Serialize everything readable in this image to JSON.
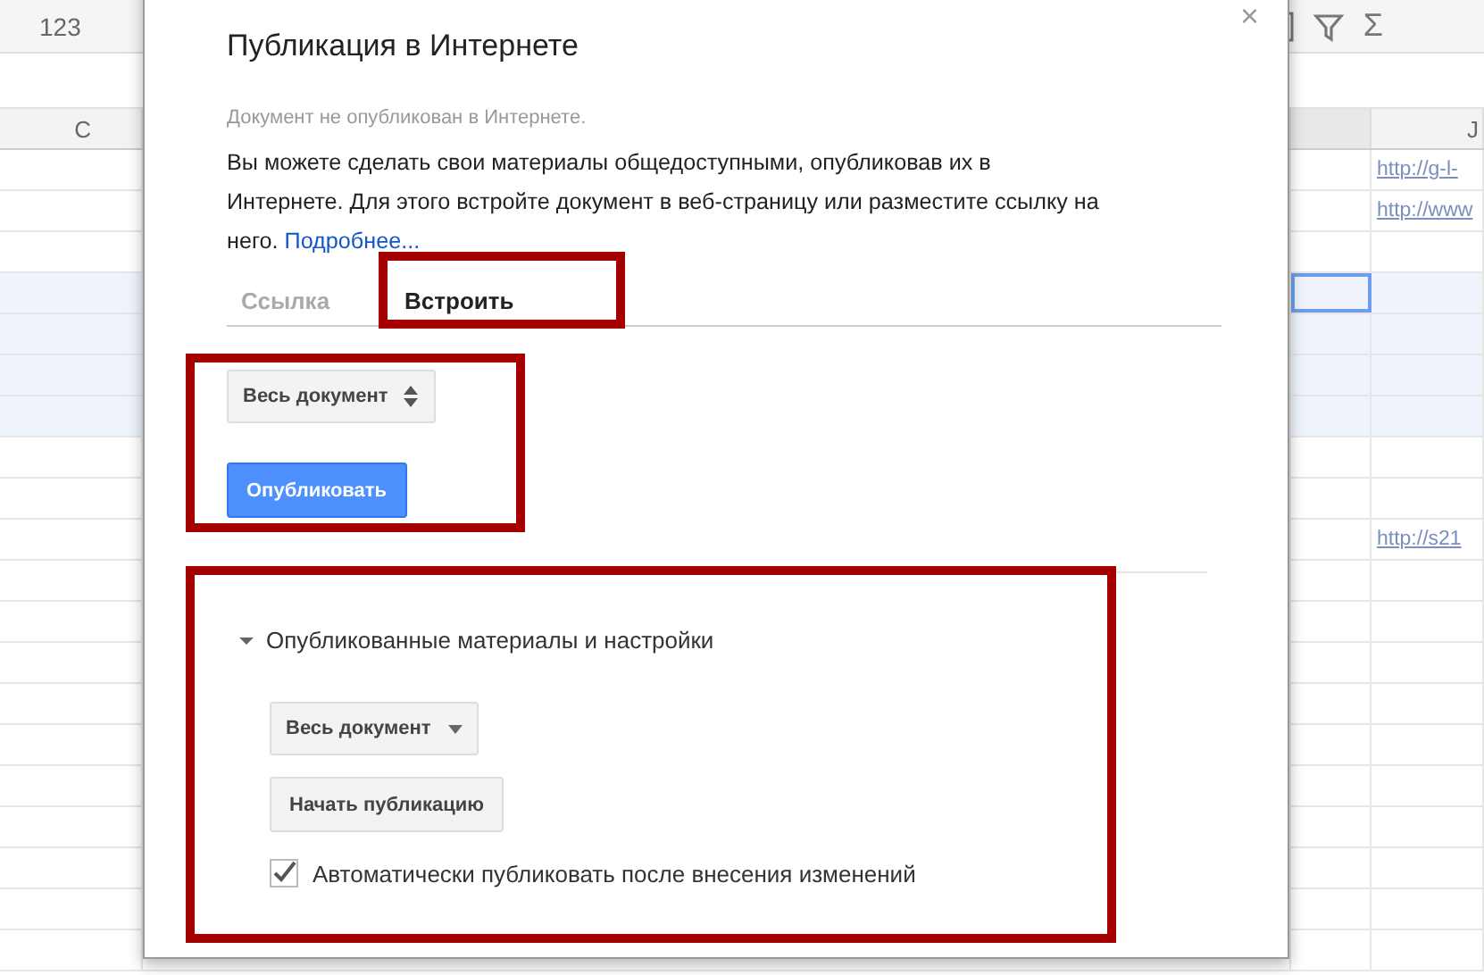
{
  "toolbar": {
    "number_format": "123",
    "sum_symbol": "Σ"
  },
  "columns": [
    "C",
    "J"
  ],
  "rows": [
    {
      "selected": false,
      "in_range": false,
      "link": "http://g-l-"
    },
    {
      "selected": false,
      "in_range": false,
      "link": "http://www"
    },
    {
      "selected": false,
      "in_range": false
    },
    {
      "selected": true,
      "in_range": true
    },
    {
      "selected": false,
      "in_range": true
    },
    {
      "selected": false,
      "in_range": true
    },
    {
      "selected": false,
      "in_range": true
    },
    {
      "selected": false,
      "in_range": false
    },
    {
      "selected": false,
      "in_range": false
    },
    {
      "selected": false,
      "in_range": false,
      "link": "http://s21"
    },
    {
      "selected": false,
      "in_range": false
    },
    {
      "selected": false,
      "in_range": false
    },
    {
      "selected": false,
      "in_range": false
    },
    {
      "selected": false,
      "in_range": false
    },
    {
      "selected": false,
      "in_range": false
    },
    {
      "selected": false,
      "in_range": false
    },
    {
      "selected": false,
      "in_range": false
    },
    {
      "selected": false,
      "in_range": false
    },
    {
      "selected": false,
      "in_range": false
    },
    {
      "selected": false,
      "in_range": false
    }
  ],
  "dialog": {
    "close": "×",
    "title": "Публикация в Интернете",
    "status": "Документ не опубликован в Интернете.",
    "description": "Вы можете сделать свои материалы общедоступными, опубликовав их в Интернете. Для этого встройте документ в веб-страницу или разместите ссылку на него.",
    "more_link": "Подробнее...",
    "tabs": [
      {
        "label": "Ссылка",
        "selected": false
      },
      {
        "label": "Встроить",
        "selected": true
      }
    ],
    "scope_select": "Весь документ",
    "publish_button": "Опубликовать",
    "settings": {
      "title": "Опубликованные материалы и настройки",
      "expanded": true,
      "scope_select": "Весь документ",
      "start_button": "Начать публикацию",
      "auto_publish": {
        "label": "Автоматически публиковать после внесения изменений",
        "checked": true
      }
    }
  },
  "highlight_frames": [
    {
      "kind": "tab"
    },
    {
      "kind": "publish_controls"
    },
    {
      "kind": "published_settings"
    }
  ]
}
